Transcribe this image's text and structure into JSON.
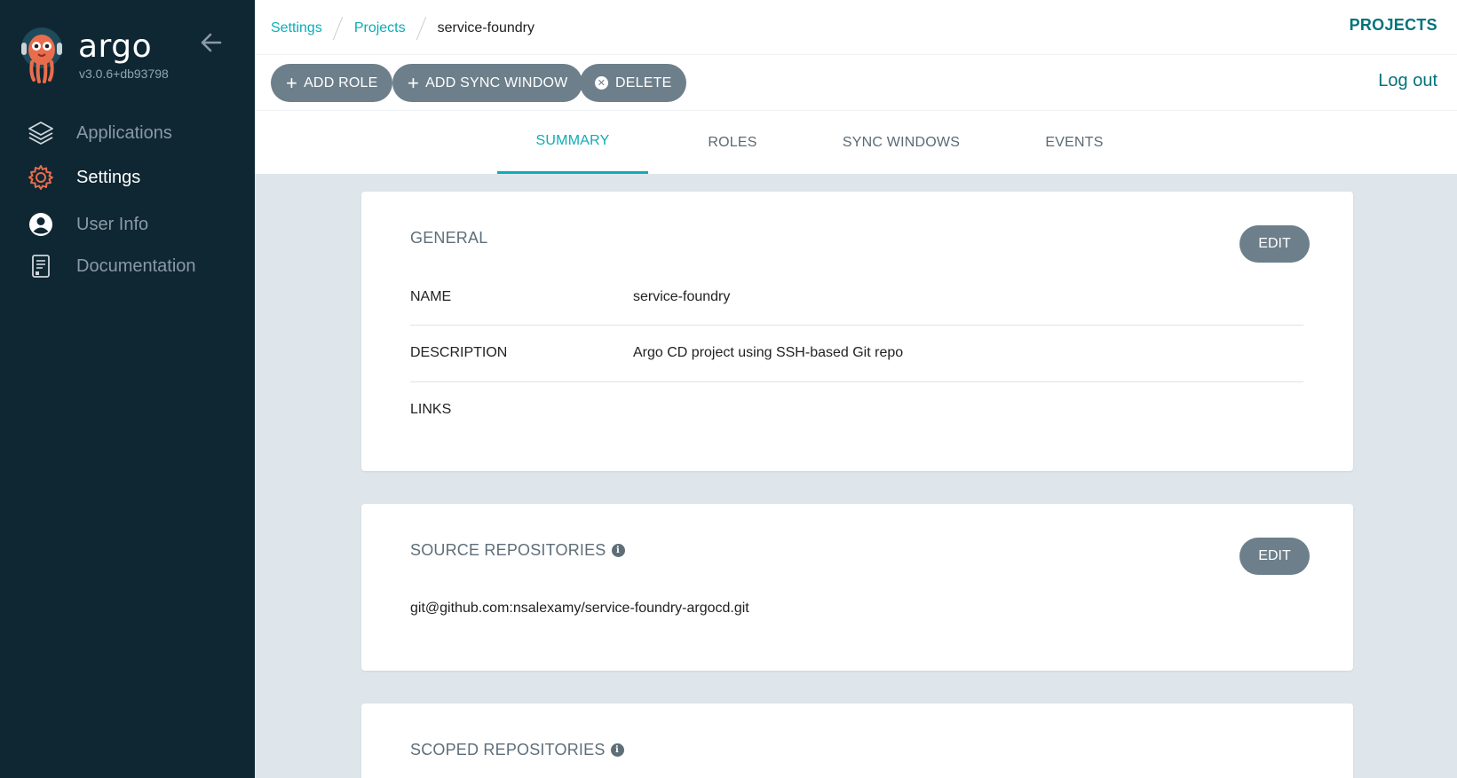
{
  "sidebar": {
    "brand": "argo",
    "version": "v3.0.6+db93798",
    "items": [
      {
        "label": "Applications",
        "icon": "layers-icon"
      },
      {
        "label": "Settings",
        "icon": "gear-icon"
      },
      {
        "label": "User Info",
        "icon": "user-icon"
      },
      {
        "label": "Documentation",
        "icon": "book-icon"
      }
    ],
    "active_item": "Settings",
    "active_icon_color": "#e96d4c"
  },
  "breadcrumb": {
    "items": [
      "Settings",
      "Projects"
    ],
    "current": "service-foundry"
  },
  "header": {
    "title": "PROJECTS",
    "logout_label": "Log out"
  },
  "toolbar": {
    "add_role_label": "ADD ROLE",
    "add_sync_window_label": "ADD SYNC WINDOW",
    "delete_label": "DELETE"
  },
  "tabs": [
    {
      "label": "SUMMARY",
      "active": true
    },
    {
      "label": "ROLES",
      "active": false
    },
    {
      "label": "SYNC WINDOWS",
      "active": false
    },
    {
      "label": "EVENTS",
      "active": false
    }
  ],
  "general": {
    "title": "GENERAL",
    "edit_label": "EDIT",
    "rows": [
      {
        "key": "NAME",
        "value": "service-foundry"
      },
      {
        "key": "DESCRIPTION",
        "value": "Argo CD project using SSH-based Git repo"
      },
      {
        "key": "LINKS",
        "value": ""
      }
    ]
  },
  "source_repositories": {
    "title": "SOURCE REPOSITORIES",
    "edit_label": "EDIT",
    "items": [
      "git@github.com:nsalexamy/service-foundry-argocd.git"
    ]
  },
  "scoped_repositories": {
    "title": "SCOPED REPOSITORIES"
  },
  "colors": {
    "accent": "#0dadb7",
    "sidebar_bg": "#0f2733",
    "button_bg": "#6d7f8b",
    "page_bg": "#dee6eb"
  }
}
